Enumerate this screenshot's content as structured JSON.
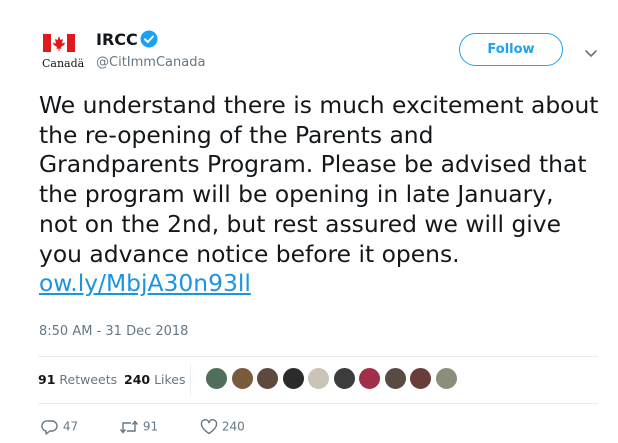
{
  "account": {
    "name": "IRCC",
    "handle": "@CitImmCanada",
    "logo_wordmark": "Canadä"
  },
  "header": {
    "follow_label": "Follow"
  },
  "tweet": {
    "text": "We understand there is much excitement about the re-opening of the Parents and Grandparents Program. Please be advised that the program will be opening in late January, not on the 2nd, but rest assured we will give you advance notice before it opens.",
    "link": "ow.ly/MbjA30n93ll",
    "timestamp": "8:50 AM - 31 Dec 2018"
  },
  "stats": {
    "retweets_count": "91",
    "retweets_label": "Retweets",
    "likes_count": "240",
    "likes_label": "Likes"
  },
  "liker_avatars": [
    {
      "color": "#4f6f5a"
    },
    {
      "color": "#7a5a3c"
    },
    {
      "color": "#5c4a3f"
    },
    {
      "color": "#2b2b2b"
    },
    {
      "color": "#c9c3b8"
    },
    {
      "color": "#3c3c3c"
    },
    {
      "color": "#a0304a"
    },
    {
      "color": "#5a4a44"
    },
    {
      "color": "#6a3d3d"
    },
    {
      "color": "#8a8f7a"
    }
  ],
  "actions": {
    "reply_count": "47",
    "retweet_count": "91",
    "like_count": "240"
  },
  "colors": {
    "accent": "#1da1f2",
    "link": "#1c94e0",
    "flag_red": "#e0191e"
  }
}
